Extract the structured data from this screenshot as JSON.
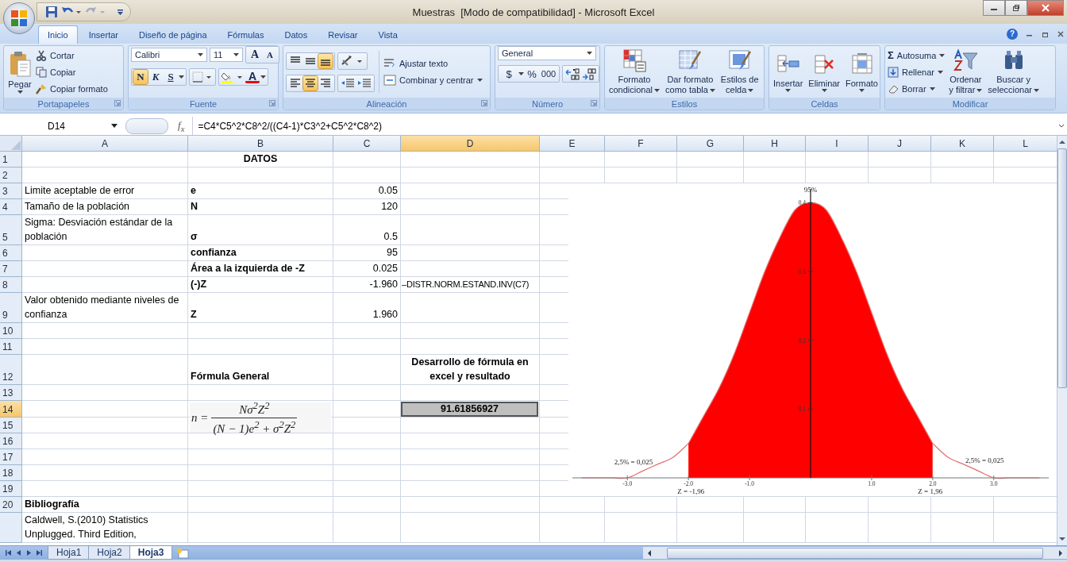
{
  "window": {
    "title": "Muestras  [Modo de compatibilidad] - Microsoft Excel",
    "help": "?"
  },
  "ribbon_tabs": [
    {
      "label": "Inicio",
      "selected": true
    },
    {
      "label": "Insertar",
      "selected": false
    },
    {
      "label": "Diseño de página",
      "selected": false
    },
    {
      "label": "Fórmulas",
      "selected": false
    },
    {
      "label": "Datos",
      "selected": false
    },
    {
      "label": "Revisar",
      "selected": false
    },
    {
      "label": "Vista",
      "selected": false
    }
  ],
  "clipboard": {
    "label": "Portapapeles",
    "paste": "Pegar",
    "cut": "Cortar",
    "copy": "Copiar",
    "format_painter": "Copiar formato"
  },
  "font": {
    "label": "Fuente",
    "name": "Calibri",
    "size": "11",
    "grow": "A",
    "shrink": "A",
    "color_letter": "A",
    "styles": [
      {
        "label": "N",
        "kind": "bold",
        "on": true
      },
      {
        "label": "K",
        "kind": "italic",
        "on": false
      },
      {
        "label": "S",
        "kind": "underline",
        "on": false
      }
    ]
  },
  "alignment": {
    "label": "Alineación",
    "wrap": "Ajustar texto",
    "merge": "Combinar y centrar",
    "vertical": [
      {
        "kind": "top",
        "on": false
      },
      {
        "kind": "middle",
        "on": false
      },
      {
        "kind": "bottom",
        "on": true
      }
    ],
    "horizontal": [
      {
        "kind": "left",
        "on": false
      },
      {
        "kind": "center",
        "on": true
      },
      {
        "kind": "right",
        "on": false
      }
    ]
  },
  "number": {
    "label": "Número",
    "format": "General",
    "currency": "$",
    "percent": "%",
    "thousands": "000"
  },
  "styles": {
    "label": "Estilos",
    "buttons": [
      {
        "kind": "conditional",
        "lines": [
          "Formato",
          "condicional"
        ]
      },
      {
        "kind": "table",
        "lines": [
          "Dar formato",
          "como tabla"
        ]
      },
      {
        "kind": "cell",
        "lines": [
          "Estilos de",
          "celda"
        ]
      }
    ]
  },
  "cells": {
    "label": "Celdas",
    "buttons": [
      {
        "kind": "insert",
        "label": "Insertar"
      },
      {
        "kind": "delete",
        "label": "Eliminar"
      },
      {
        "kind": "format",
        "label": "Formato"
      }
    ]
  },
  "editing": {
    "label": "Modificar",
    "autosum_symbol": "Σ",
    "autosum": "Autosuma",
    "fill": "Rellenar",
    "clear": "Borrar",
    "sort": [
      "Ordenar",
      "y filtrar"
    ],
    "find": [
      "Buscar y",
      "seleccionar"
    ]
  },
  "formula_bar": {
    "name_box": "D14",
    "fx": "f$_{x}$",
    "formula": "=C4*C5^2*C8^2/((C4-1)*C3^2+C5^2*C8^2)"
  },
  "sheet": {
    "columns": [
      {
        "label": "A",
        "selected": false
      },
      {
        "label": "B",
        "selected": false
      },
      {
        "label": "C",
        "selected": false
      },
      {
        "label": "D",
        "selected": true
      },
      {
        "label": "E",
        "selected": false
      },
      {
        "label": "F",
        "selected": false
      },
      {
        "label": "G",
        "selected": false
      },
      {
        "label": "H",
        "selected": false
      },
      {
        "label": "I",
        "selected": false
      },
      {
        "label": "J",
        "selected": false
      },
      {
        "label": "K",
        "selected": false
      },
      {
        "label": "L",
        "selected": false
      }
    ],
    "rows": [
      {
        "number": "1",
        "selected": false,
        "col_b": {
          "kind": "heading",
          "text": "DATOS"
        }
      },
      {
        "number": "2",
        "selected": false
      },
      {
        "number": "3",
        "selected": false,
        "col_a": {
          "kind": "text",
          "text": "Limite aceptable de error"
        },
        "col_b": {
          "kind": "bold",
          "text": "e"
        },
        "col_c": {
          "kind": "number",
          "text": "0.05"
        }
      },
      {
        "number": "4",
        "selected": false,
        "col_a": {
          "kind": "text",
          "text": "Tamaño de la población"
        },
        "col_b": {
          "kind": "bold",
          "text": "N"
        },
        "col_c": {
          "kind": "number",
          "text": "120"
        }
      },
      {
        "number": "5",
        "selected": false,
        "col_a": {
          "kind": "text",
          "text": "Sigma: Desviación estándar de la población"
        },
        "col_b": {
          "kind": "bold",
          "text": "σ"
        },
        "col_c": {
          "kind": "number",
          "text": "0.5"
        }
      },
      {
        "number": "6",
        "selected": false,
        "col_b": {
          "kind": "bold",
          "text": "confianza"
        },
        "col_c": {
          "kind": "number",
          "text": "95"
        }
      },
      {
        "number": "7",
        "selected": false,
        "col_b": {
          "kind": "bold",
          "text": "Área a la izquierda de -Z"
        },
        "col_c": {
          "kind": "number",
          "text": "0.025"
        }
      },
      {
        "number": "8",
        "selected": false,
        "col_b": {
          "kind": "bold",
          "text": "(-)Z"
        },
        "col_c": {
          "kind": "number",
          "text": "-1.960"
        },
        "col_d": {
          "kind": "spill",
          "text": "–DISTR.NORM.ESTAND.INV(C7)"
        }
      },
      {
        "number": "9",
        "selected": false,
        "col_a": {
          "kind": "text",
          "text": "Valor obtenido mediante niveles de confianza"
        },
        "col_b": {
          "kind": "bold",
          "text": "Z"
        },
        "col_c": {
          "kind": "number",
          "text": "1.960"
        }
      },
      {
        "number": "10",
        "selected": false
      },
      {
        "number": "11",
        "selected": false
      },
      {
        "number": "12",
        "selected": false,
        "col_b": {
          "kind": "bold",
          "text": "Fórmula General"
        },
        "col_d": {
          "kind": "heading",
          "text": "Desarrollo de fórmula en excel y resultado"
        }
      },
      {
        "number": "13",
        "selected": false
      },
      {
        "number": "14",
        "selected": true,
        "col_d": {
          "kind": "result",
          "text": "91.61856927"
        }
      },
      {
        "number": "15",
        "selected": false
      },
      {
        "number": "16",
        "selected": false
      },
      {
        "number": "17",
        "selected": false
      },
      {
        "number": "18",
        "selected": false
      },
      {
        "number": "19",
        "selected": false
      },
      {
        "number": "20",
        "selected": false,
        "col_a": {
          "kind": "bold",
          "text": "Bibliografía"
        }
      },
      {
        "selected": false,
        "col_a": {
          "kind": "text",
          "text": "Caldwell, S.(2010) Statistics Unplugged. Third Edition,"
        }
      }
    ]
  },
  "formula_picture": {
    "lhs": "n =",
    "numerator": "Nσ$^{2}$Z$^{2}$",
    "denominator": "(N − 1)e$^{2}$ + σ$^{2}$Z$^{2}$"
  },
  "chart": {
    "chart_data": {
      "type": "area",
      "x": [
        -3.75,
        -3.5,
        -3.25,
        -3,
        -2.75,
        -2.5,
        -2.25,
        -2,
        -1.75,
        -1.5,
        -1.25,
        -1,
        -0.75,
        -0.5,
        -0.25,
        0,
        0.25,
        0.5,
        0.75,
        1,
        1.25,
        1.5,
        1.75,
        2,
        2.25,
        2.5,
        2.75,
        3,
        3.25,
        3.5,
        3.75
      ],
      "series": [
        {
          "color": "#ffffff",
          "values": [
            0,
            0,
            0,
            0,
            0.01,
            0.02,
            0.03,
            0.05,
            null,
            null,
            null,
            null,
            null,
            null,
            null,
            null,
            null,
            null,
            null,
            null,
            null,
            null,
            null,
            null,
            null,
            null,
            null,
            null,
            null,
            null,
            null
          ]
        },
        {
          "color": "#ff0000",
          "values": [
            null,
            null,
            null,
            null,
            null,
            null,
            null,
            0.05,
            0.09,
            0.13,
            0.18,
            0.24,
            0.3,
            0.35,
            0.39,
            0.4,
            0.39,
            0.35,
            0.3,
            0.24,
            0.18,
            0.13,
            0.09,
            0.05,
            null,
            null,
            null,
            null,
            null,
            null,
            null
          ]
        },
        {
          "color": "#ffffff",
          "values": [
            null,
            null,
            null,
            null,
            null,
            null,
            null,
            null,
            null,
            null,
            null,
            null,
            null,
            null,
            null,
            null,
            null,
            null,
            null,
            null,
            null,
            null,
            null,
            0.05,
            0.03,
            0.02,
            0.01,
            0,
            0,
            0,
            0
          ]
        }
      ],
      "xlim": [
        -3.9,
        3.9
      ],
      "ylim": [
        0,
        0.42
      ],
      "xticks": [
        {
          "value": -3,
          "label": "-3.0"
        },
        {
          "value": -2,
          "label": "-2.0"
        },
        {
          "value": -1,
          "label": "-1.0"
        },
        {
          "value": 1,
          "label": "1.0"
        },
        {
          "value": 2,
          "label": "2.0"
        },
        {
          "value": 3,
          "label": "3.0"
        }
      ],
      "yticks": [
        {
          "value": 0.1,
          "label": "0.1"
        },
        {
          "value": 0.2,
          "label": "0.2"
        },
        {
          "value": 0.3,
          "label": "0.3"
        },
        {
          "value": 0.4,
          "label": "0.4"
        }
      ],
      "annotations": [
        "95%",
        "2,5% = 0,025",
        "2,5% = 0,025",
        "Z = -1,96",
        "Z = 1,96"
      ]
    }
  },
  "sheet_tabs": [
    {
      "label": "Hoja1",
      "selected": false
    },
    {
      "label": "Hoja2",
      "selected": false
    },
    {
      "label": "Hoja3",
      "selected": true
    }
  ]
}
